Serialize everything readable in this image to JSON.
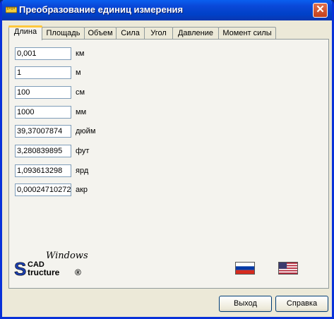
{
  "window": {
    "title": "Преобразование единиц измерения",
    "close_label": "✕"
  },
  "tabs": [
    {
      "label": "Длина",
      "active": true
    },
    {
      "label": "Площадь",
      "active": false
    },
    {
      "label": "Объем",
      "active": false
    },
    {
      "label": "Сила",
      "active": false
    },
    {
      "label": "Угол",
      "active": false
    },
    {
      "label": "Давление",
      "active": false
    },
    {
      "label": "Момент силы",
      "active": false
    }
  ],
  "units": [
    {
      "value": "0,001",
      "unit": "км"
    },
    {
      "value": "1",
      "unit": "м"
    },
    {
      "value": "100",
      "unit": "см"
    },
    {
      "value": "1000",
      "unit": "мм"
    },
    {
      "value": "39,37007874",
      "unit": "дюйм"
    },
    {
      "value": "3,280839895",
      "unit": "фут"
    },
    {
      "value": "1,093613298",
      "unit": "ярд"
    },
    {
      "value": "0,000247102720",
      "unit": "акр"
    }
  ],
  "logo": {
    "line1": "Windows",
    "brand_top": "CAD",
    "brand_bottom": "tructure",
    "brand_s": "S",
    "reg": "®"
  },
  "flags": [
    {
      "name": "Russian",
      "colors": [
        "#ffffff",
        "#0039a6",
        "#d52b1e"
      ]
    },
    {
      "name": "English",
      "colors": [
        "#b22234",
        "#ffffff",
        "#3c3b6e"
      ]
    }
  ],
  "buttons": {
    "exit_label": "Выход",
    "help_label": "Справка"
  },
  "colors": {
    "titlebar": "#0a48d8",
    "face": "#ece9d8",
    "tab_highlight": "#ffc83c"
  }
}
